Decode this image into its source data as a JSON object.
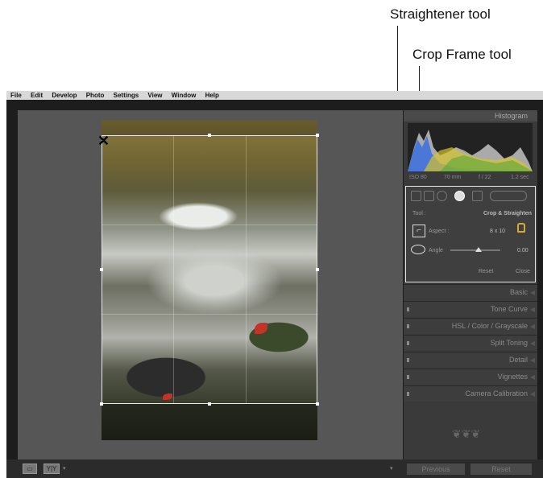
{
  "callouts": {
    "straightener": "Straightener tool",
    "crop_frame": "Crop Frame tool"
  },
  "menu": [
    "File",
    "Edit",
    "Develop",
    "Photo",
    "Settings",
    "View",
    "Window",
    "Help"
  ],
  "histogram": {
    "title": "Histogram",
    "info": [
      "ISO 80",
      "70 mm",
      "f / 22",
      "1.2 sec"
    ]
  },
  "crop_tool": {
    "tool_label": "Tool :",
    "tool_value": "Crop & Straighten",
    "aspect_label": "Aspect :",
    "aspect_value": "8 x 10",
    "angle_label": "Angle",
    "angle_value": "0.00",
    "angle_fraction": 0.5,
    "reset": "Reset",
    "close": "Close"
  },
  "sections": [
    "Basic",
    "Tone Curve",
    "HSL  /  Color  /  Grayscale",
    "Split Toning",
    "Detail",
    "Vignettes",
    "Camera Calibration"
  ],
  "bottom": {
    "previous": "Previous",
    "reset": "Reset"
  },
  "colors": {
    "panel": "#3a3a3a",
    "accent_lock": "#d9a933"
  }
}
